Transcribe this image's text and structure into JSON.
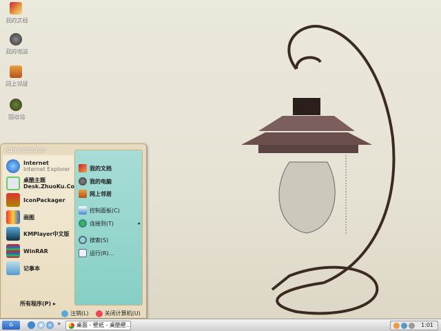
{
  "desktop": {
    "icons": [
      {
        "label": "我的文档",
        "icon": "my-documents-icon"
      },
      {
        "label": "我的电脑",
        "icon": "my-computer-icon"
      },
      {
        "label": "网上邻居",
        "icon": "network-places-icon"
      },
      {
        "label": "回收站",
        "icon": "recycle-bin-icon"
      }
    ]
  },
  "start_menu": {
    "user": "Administrator",
    "pinned": [
      {
        "title": "Internet",
        "subtitle": "Internet Explorer",
        "icon": "ie-icon"
      },
      {
        "title": "桌酷主题",
        "subtitle": "Desk.ZhuoKu.Com",
        "icon": "zhuoku-icon"
      },
      {
        "title": "IconPackager",
        "icon": "iconpackager-icon"
      },
      {
        "title": "画图",
        "icon": "paint-icon"
      },
      {
        "title": "KMPlayer中文版",
        "icon": "kmplayer-icon"
      },
      {
        "title": "WinRAR",
        "icon": "winrar-icon"
      },
      {
        "title": "记事本",
        "icon": "notepad-icon"
      }
    ],
    "all_programs": "所有程序(P)",
    "places": [
      {
        "label": "我的文档"
      },
      {
        "label": "我的电脑"
      },
      {
        "label": "网上邻居"
      },
      {
        "label": "控制面板(C)"
      },
      {
        "label": "连接到(T)"
      },
      {
        "label": "搜索(S)"
      },
      {
        "label": "运行(R)..."
      }
    ],
    "logoff": "注销(L)",
    "shutdown": "关闭计算机(U)"
  },
  "taskbar": {
    "chevron": "»",
    "task": "桌面 - 壁纸 - 桌酷壁...",
    "clock": "1:01"
  }
}
